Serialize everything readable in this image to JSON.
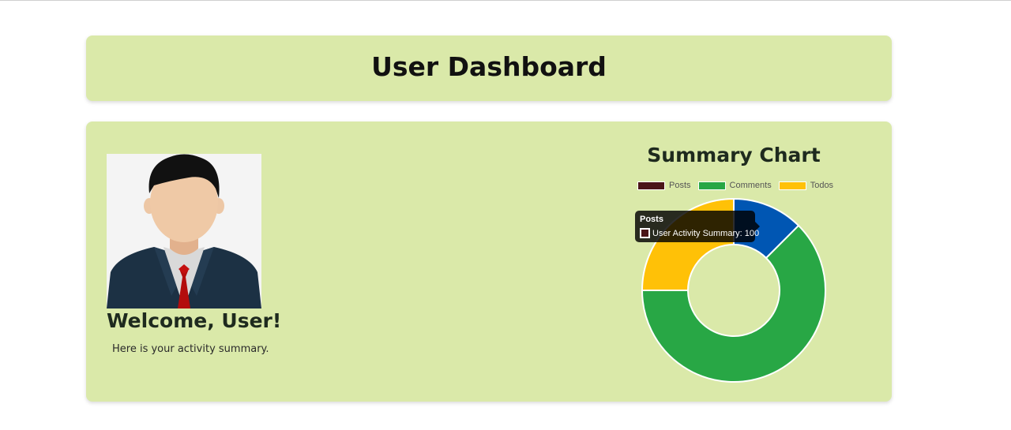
{
  "header": {
    "title": "User Dashboard"
  },
  "profile": {
    "welcome": "Welcome, User!",
    "subtitle": "Here is your activity summary.",
    "avatar_icon": "user-avatar-businessman-icon"
  },
  "chart": {
    "title": "Summary Chart",
    "tooltip": {
      "title": "Posts",
      "label": "User Activity Summary: 100",
      "swatch_color": "#4a1518"
    }
  },
  "colors": {
    "card_bg": "#dae9a9",
    "posts_legend": "#4a1518",
    "comments": "#28a745",
    "todos": "#ffc107",
    "posts_slice": "#0056b3"
  },
  "chart_data": {
    "type": "pie",
    "title": "Summary Chart",
    "categories": [
      "Posts",
      "Comments",
      "Todos"
    ],
    "series": [
      {
        "name": "User Activity Summary",
        "values": [
          100,
          500,
          200
        ]
      }
    ],
    "legend_colors": [
      "#4a1518",
      "#28a745",
      "#ffc107"
    ],
    "slice_colors": [
      "#0056b3",
      "#28a745",
      "#ffc107"
    ],
    "legend_position": "top",
    "donut": true
  }
}
